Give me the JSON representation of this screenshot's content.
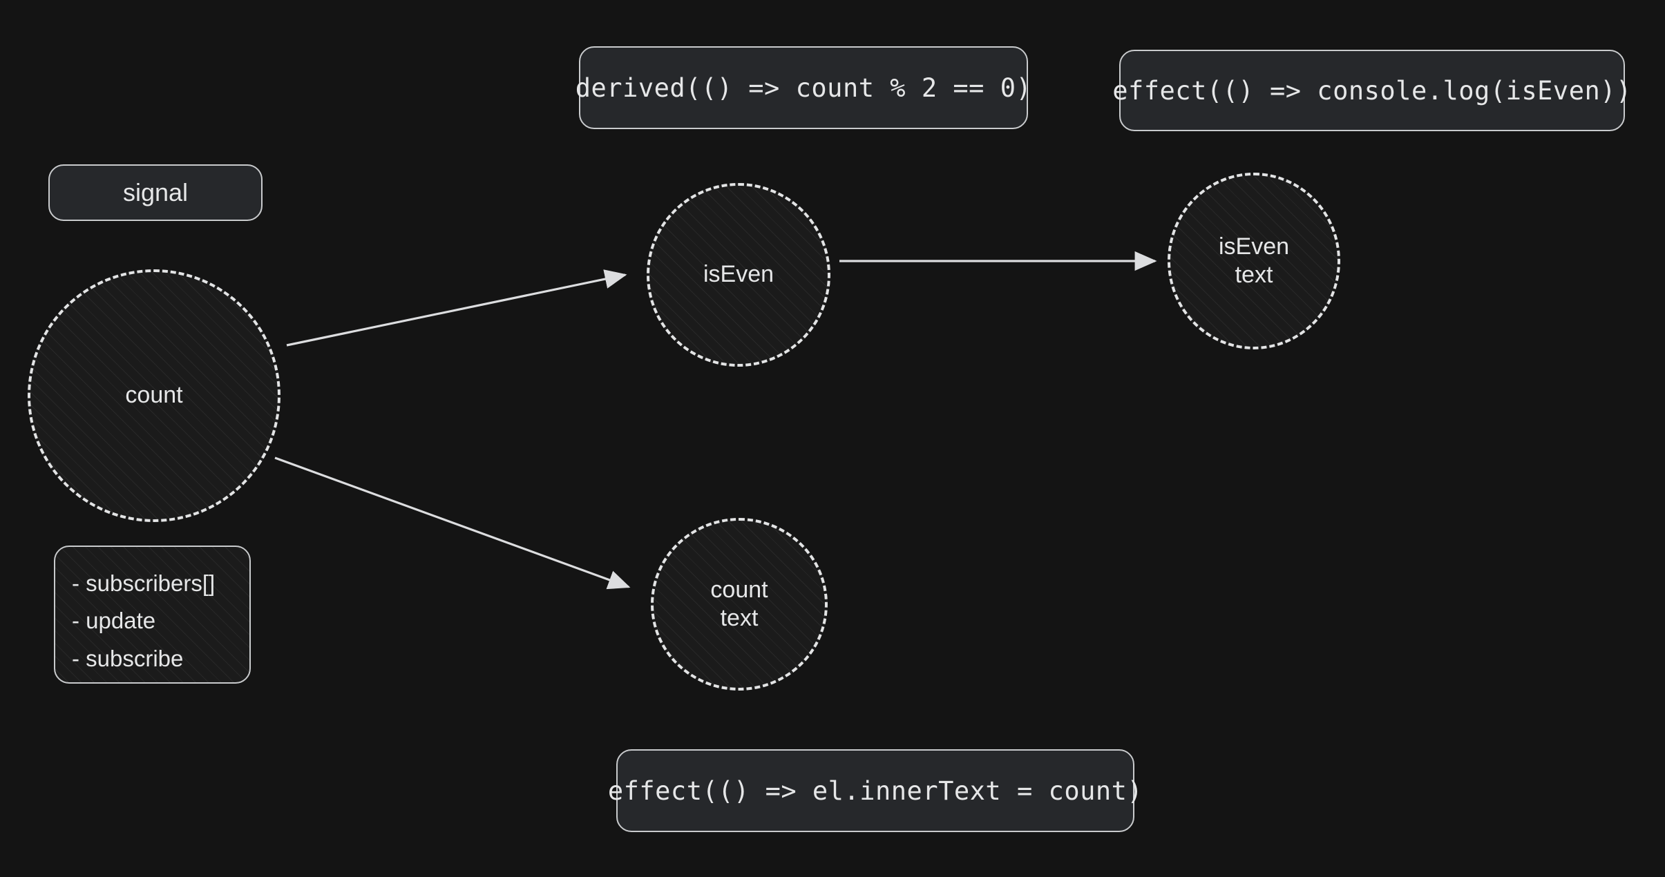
{
  "canvas": {
    "background": "#141414",
    "stroke": "#e3e4e5",
    "box_fill": "#26282b",
    "text": "#e6e7e8"
  },
  "labels": {
    "signal": "signal"
  },
  "code_boxes": {
    "derived": "derived(() => count % 2 == 0)",
    "effect_log": "effect(() => console.log(isEven))",
    "effect_inner_text": "effect(() => el.innerText = count)"
  },
  "nodes": {
    "count": {
      "label": "count",
      "lines": [
        "count"
      ]
    },
    "is_even": {
      "label": "isEven",
      "lines": [
        "isEven"
      ]
    },
    "is_even_text": {
      "label": "isEven text",
      "lines": [
        "isEven",
        "text"
      ]
    },
    "count_text": {
      "label": "count text",
      "lines": [
        "count",
        "text"
      ]
    }
  },
  "members_box": {
    "items": [
      "- subscribers[]",
      "- update",
      "- subscribe"
    ]
  },
  "edges": [
    {
      "from": "count",
      "to": "is_even",
      "style": "solid-arrow"
    },
    {
      "from": "count",
      "to": "count_text",
      "style": "solid-arrow"
    },
    {
      "from": "is_even",
      "to": "is_even_text",
      "style": "solid-arrow"
    }
  ]
}
